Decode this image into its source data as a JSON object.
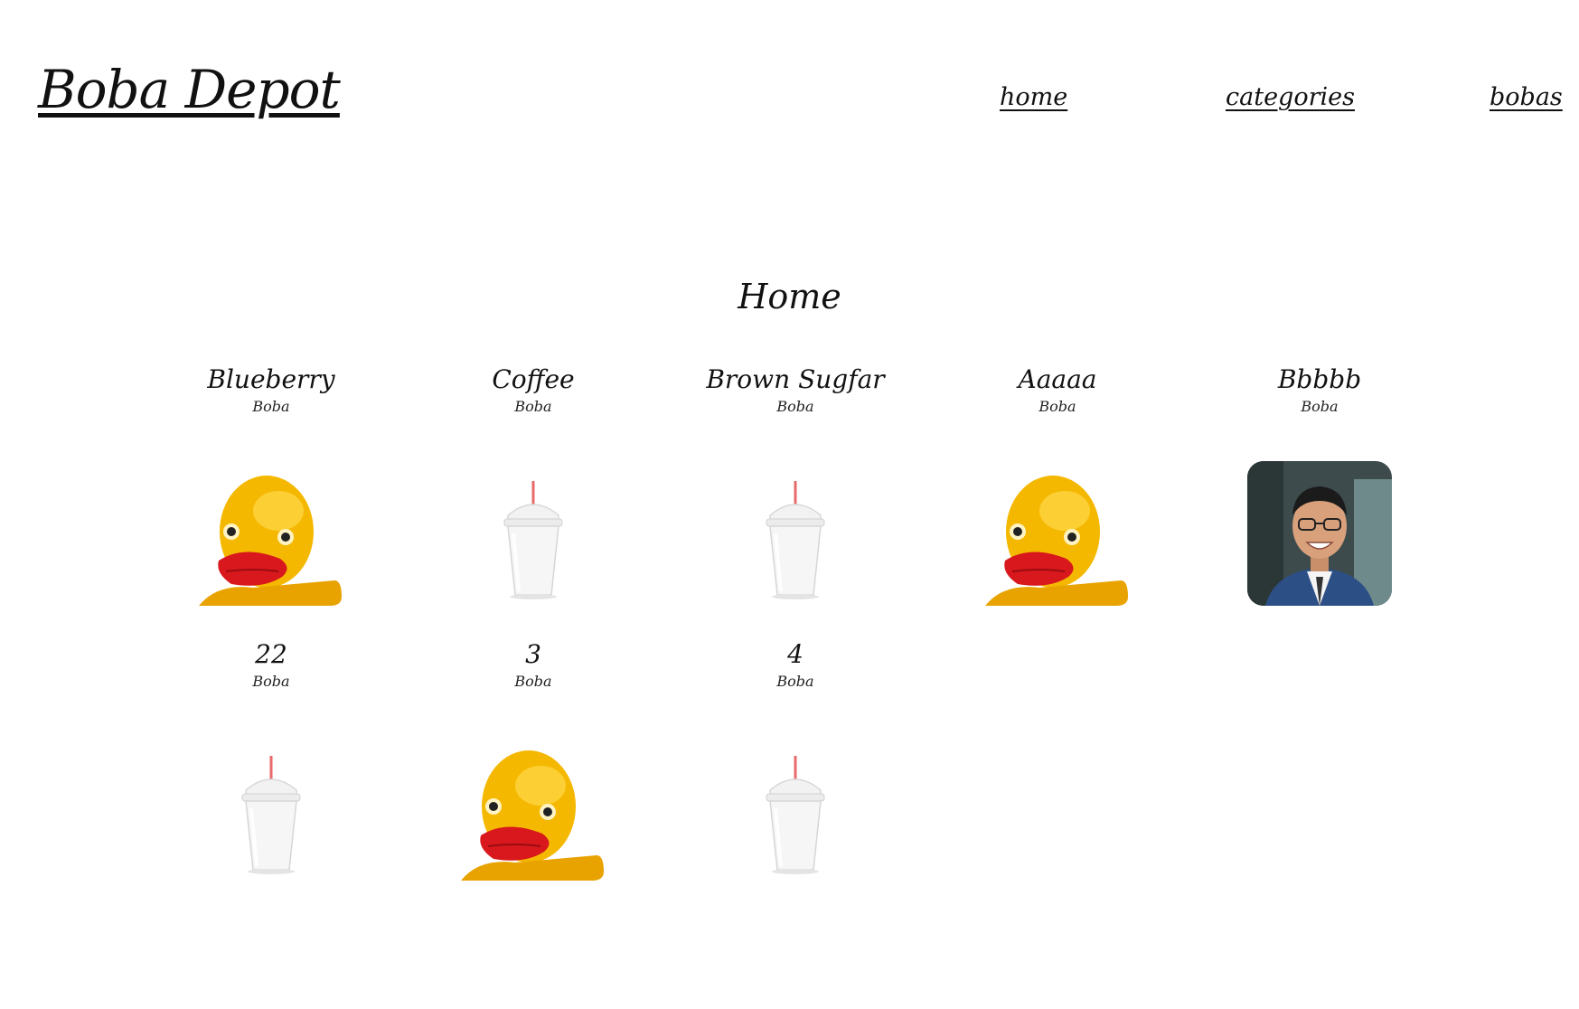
{
  "header": {
    "brand": "Boba Depot",
    "nav": [
      {
        "label": "home"
      },
      {
        "label": "categories"
      },
      {
        "label": "bobas"
      }
    ]
  },
  "page_title": "Home",
  "items": [
    {
      "name": "Blueberry",
      "category": "Boba",
      "image": "rubber-duck"
    },
    {
      "name": "Coffee",
      "category": "Boba",
      "image": "boba-cup"
    },
    {
      "name": "Brown Sugfar",
      "category": "Boba",
      "image": "boba-cup"
    },
    {
      "name": "Aaaaa",
      "category": "Boba",
      "image": "rubber-duck"
    },
    {
      "name": "Bbbbb",
      "category": "Boba",
      "image": "person-photo"
    },
    {
      "name": "22",
      "category": "Boba",
      "image": "boba-cup"
    },
    {
      "name": "3",
      "category": "Boba",
      "image": "rubber-duck"
    },
    {
      "name": "4",
      "category": "Boba",
      "image": "boba-cup"
    }
  ],
  "colors": {
    "background": "#ffffff",
    "text": "#111111",
    "duck_yellow": "#f5b800",
    "duck_beak": "#d8181c",
    "straw": "#e86a6a"
  }
}
